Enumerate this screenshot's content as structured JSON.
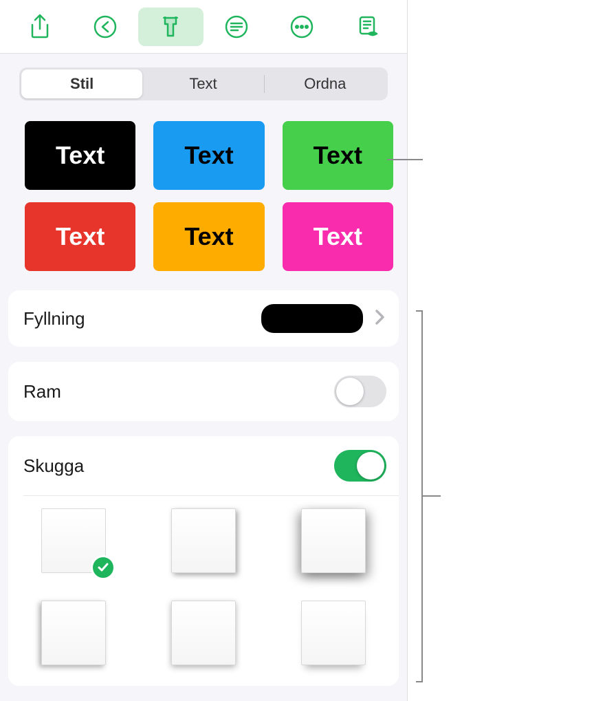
{
  "accent": "#1fb55d",
  "toolbar": {
    "icons": [
      "share",
      "undo",
      "format",
      "text-options",
      "more",
      "reading-view"
    ],
    "active_index": 2
  },
  "tabs": {
    "items": [
      "Stil",
      "Text",
      "Ordna"
    ],
    "active_index": 0
  },
  "presets": [
    {
      "label": "Text",
      "bg": "#000000",
      "fg": "#ffffff"
    },
    {
      "label": "Text",
      "bg": "#1a9bf2",
      "fg": "#000000"
    },
    {
      "label": "Text",
      "bg": "#46cf4b",
      "fg": "#000000"
    },
    {
      "label": "Text",
      "bg": "#e7352c",
      "fg": "#ffffff"
    },
    {
      "label": "Text",
      "bg": "#feac00",
      "fg": "#000000"
    },
    {
      "label": "Text",
      "bg": "#fa2cae",
      "fg": "#ffffff"
    }
  ],
  "fill": {
    "label": "Fyllning",
    "color": "#000000"
  },
  "frame": {
    "label": "Ram",
    "enabled": false
  },
  "shadow": {
    "label": "Skugga",
    "enabled": true,
    "selected_index": 0,
    "options_count": 6
  }
}
